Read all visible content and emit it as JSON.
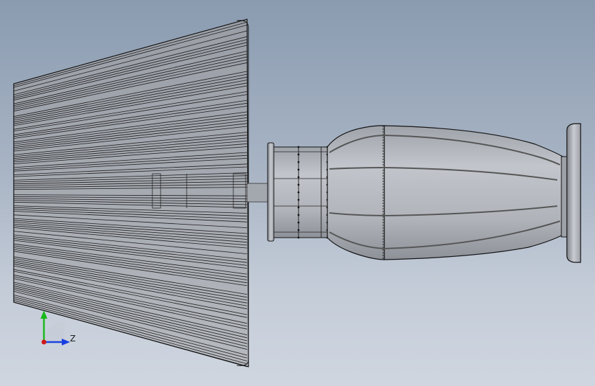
{
  "viewport": {
    "background_top": "#8a9bb0",
    "background_bottom": "#cfd6e0"
  },
  "model": {
    "panel_color": "#b8bcc4",
    "body_color": "#a9adb4",
    "outline_color": "#111111"
  },
  "triad": {
    "x_color": "#d01818",
    "y_color": "#18b818",
    "z_color": "#1840e0",
    "z_label": "Z"
  }
}
